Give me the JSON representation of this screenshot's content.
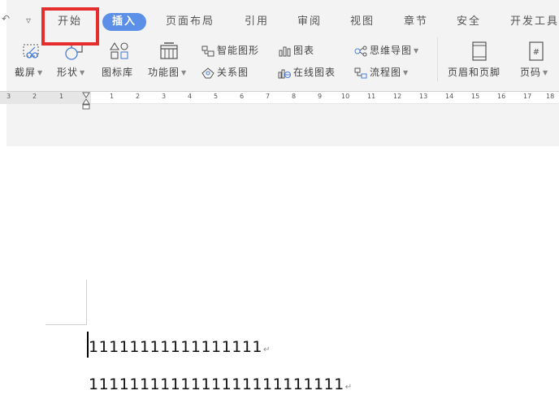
{
  "quick_access": {
    "undo_icon": "↶",
    "dropdown_icon": "▿"
  },
  "tabs": [
    {
      "label": "开始"
    },
    {
      "label": "插入"
    },
    {
      "label": "页面布局"
    },
    {
      "label": "引用"
    },
    {
      "label": "审阅"
    },
    {
      "label": "视图"
    },
    {
      "label": "章节"
    },
    {
      "label": "安全"
    },
    {
      "label": "开发工具"
    }
  ],
  "tools": {
    "screenshot": "截屏",
    "shapes": "形状",
    "icon_library": "图标库",
    "function_chart": "功能图",
    "smart_graphic": "智能图形",
    "chart": "图表",
    "mind_map": "思维导图",
    "relation_chart": "关系图",
    "online_chart": "在线图表",
    "flowchart": "流程图",
    "header_footer": "页眉和页脚",
    "page_number": "页码"
  },
  "ruler": {
    "left_ticks": [
      "3",
      "2",
      "1"
    ],
    "right_ticks": [
      "1",
      "2",
      "3",
      "4",
      "5",
      "6",
      "7",
      "8",
      "9",
      "10",
      "11",
      "12",
      "13",
      "14",
      "15",
      "16",
      "17",
      "18"
    ]
  },
  "document": {
    "line1": "11111111111111111",
    "line2": "1111111111111111111111111",
    "para_mark": "↵"
  },
  "colors": {
    "active_tab": "#5b8fe8",
    "highlight": "#e52d2d"
  }
}
